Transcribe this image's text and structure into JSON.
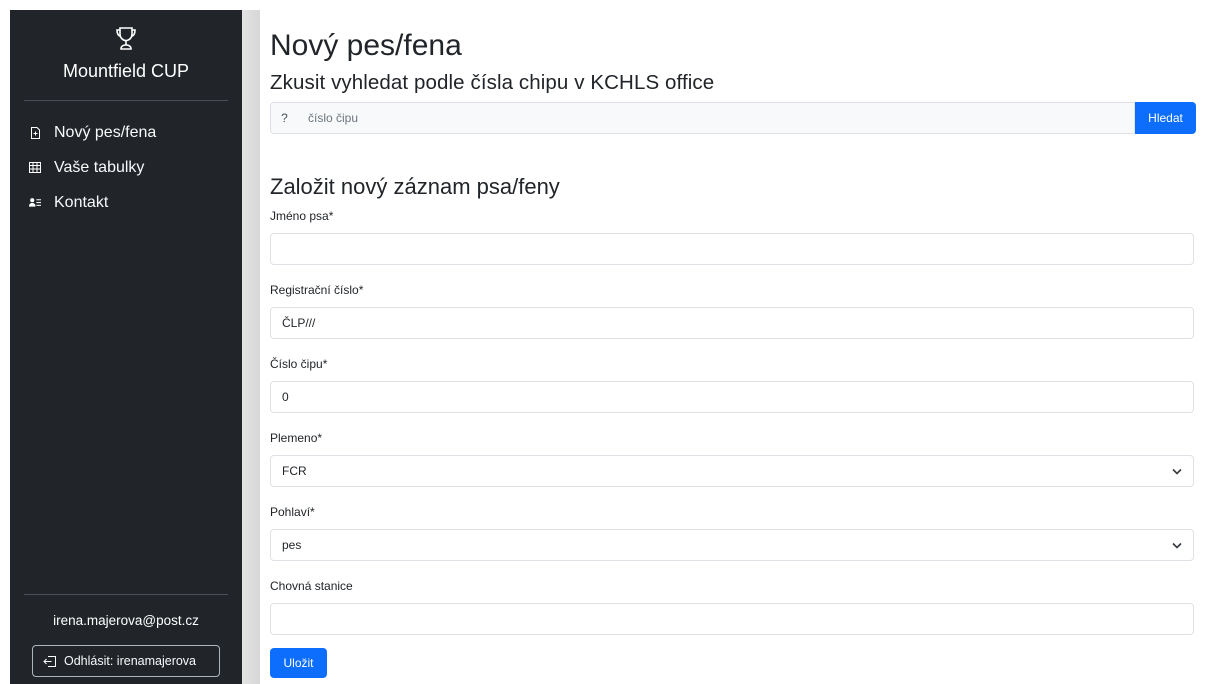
{
  "sidebar": {
    "brand_icon": "trophy-icon",
    "brand_name": "Mountfield CUP",
    "nav": [
      {
        "label": "Nový pes/fena",
        "icon": "file-plus-icon"
      },
      {
        "label": "Vaše tabulky",
        "icon": "table-icon"
      },
      {
        "label": "Kontakt",
        "icon": "person-lines-icon"
      }
    ],
    "user_email": "irena.majerova@post.cz",
    "logout_label": "Odhlásit: irenamajerova",
    "logout_icon": "box-arrow-left-icon"
  },
  "main": {
    "page_title": "Nový pes/fena",
    "search": {
      "title": "Zkusit vyhledat podle čísla chipu v KCHLS office",
      "prefix": "?",
      "placeholder": "číslo čipu",
      "button_label": "Hledat"
    },
    "form": {
      "title": "Založit nový záznam psa/feny",
      "fields": {
        "name": {
          "label": "Jméno psa*",
          "value": ""
        },
        "registration": {
          "label": "Registrační číslo*",
          "value": "ČLP///"
        },
        "chip": {
          "label": "Číslo čipu*",
          "value": "0"
        },
        "breed": {
          "label": "Plemeno*",
          "value": "FCR"
        },
        "sex": {
          "label": "Pohlaví*",
          "value": "pes"
        },
        "kennel": {
          "label": "Chovná stanice",
          "value": ""
        }
      },
      "save_label": "Uložit"
    }
  },
  "colors": {
    "sidebar_bg": "#212529",
    "primary": "#0d6efd",
    "border": "#dee2e6"
  }
}
